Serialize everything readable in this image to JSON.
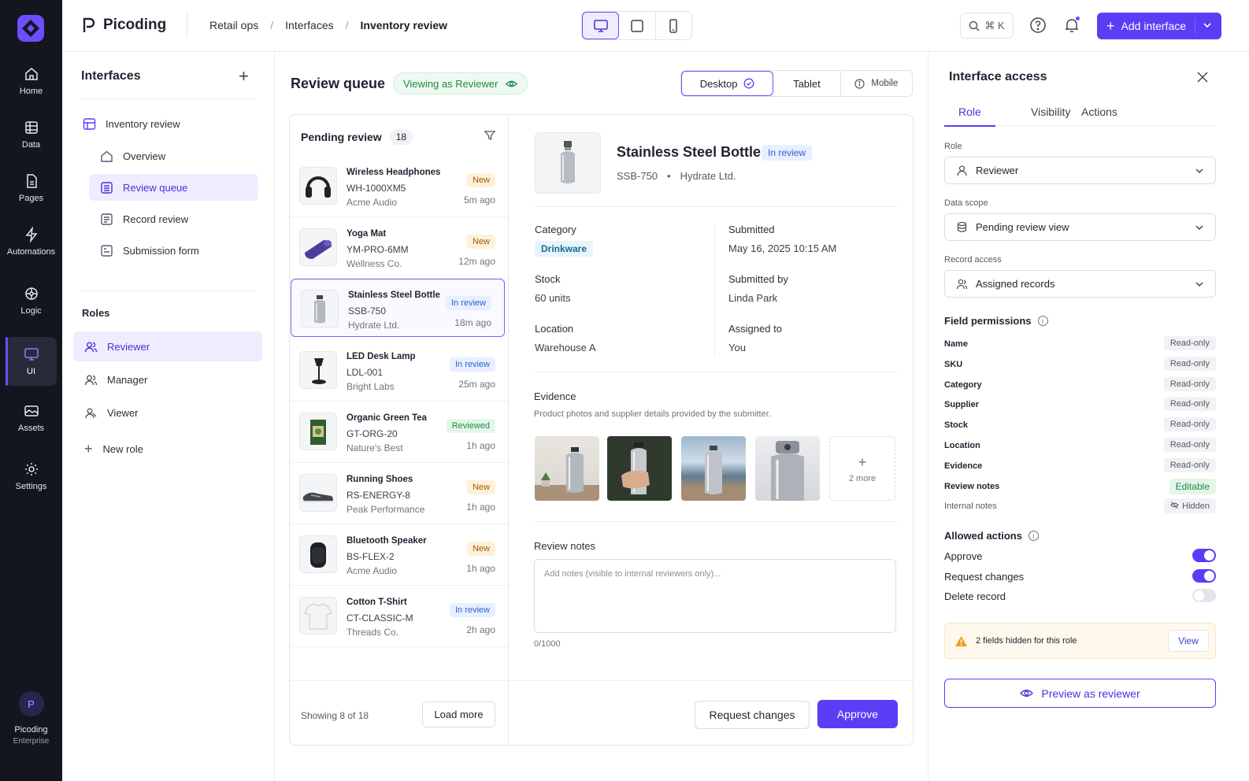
{
  "rail": {
    "items": [
      {
        "label": "Home",
        "icon": "home-icon"
      },
      {
        "label": "Data",
        "icon": "table-icon"
      },
      {
        "label": "Pages",
        "icon": "page-icon"
      },
      {
        "label": "Automations",
        "icon": "bolt-icon"
      },
      {
        "label": "Logic",
        "icon": "logic-icon"
      },
      {
        "label": "UI",
        "icon": "monitor-icon"
      },
      {
        "label": "Assets",
        "icon": "image-icon"
      },
      {
        "label": "Settings",
        "icon": "gear-icon"
      }
    ],
    "user": {
      "initial": "P",
      "name": "Picoding",
      "plan": "Enterprise"
    }
  },
  "topbar": {
    "brand": "Picoding",
    "crumbs": [
      "Retail ops",
      "Interfaces",
      "Inventory review"
    ],
    "search_shortcut": "⌘ K",
    "add_label": "Add interface"
  },
  "nav": {
    "title": "Interfaces",
    "items": [
      "Inventory review",
      "Overview",
      "Review queue",
      "Record review",
      "Submission form"
    ],
    "roles_title": "Roles",
    "roles": [
      "Reviewer",
      "Manager",
      "Viewer",
      "New role"
    ]
  },
  "main": {
    "title": "Review queue",
    "viewing": "Viewing as Reviewer",
    "device_tabs": [
      "Desktop",
      "Tablet",
      "Mobile"
    ],
    "list": {
      "title": "Pending review",
      "count": "18",
      "rows": [
        {
          "name": "Wireless Headphones",
          "sku": "WH-1000XM5",
          "vendor": "Acme Audio",
          "status": "New",
          "time": "5m ago"
        },
        {
          "name": "Yoga Mat",
          "sku": "YM-PRO-6MM",
          "vendor": "Wellness Co.",
          "status": "New",
          "time": "12m ago"
        },
        {
          "name": "Stainless Steel Bottle",
          "sku": "SSB-750",
          "vendor": "Hydrate Ltd.",
          "status": "In review",
          "time": "18m ago"
        },
        {
          "name": "LED Desk Lamp",
          "sku": "LDL-001",
          "vendor": "Bright Labs",
          "status": "In review",
          "time": "25m ago"
        },
        {
          "name": "Organic Green Tea",
          "sku": "GT-ORG-20",
          "vendor": "Nature's Best",
          "status": "Reviewed",
          "time": "1h ago"
        },
        {
          "name": "Running Shoes",
          "sku": "RS-ENERGY-8",
          "vendor": "Peak Performance",
          "status": "New",
          "time": "1h ago"
        },
        {
          "name": "Bluetooth Speaker",
          "sku": "BS-FLEX-2",
          "vendor": "Acme Audio",
          "status": "New",
          "time": "1h ago"
        },
        {
          "name": "Cotton T-Shirt",
          "sku": "CT-CLASSIC-M",
          "vendor": "Threads Co.",
          "status": "In review",
          "time": "2h ago"
        }
      ],
      "showing": "Showing 8 of 18",
      "load_more": "Load more"
    },
    "detail": {
      "name": "Stainless Steel Bottle",
      "status": "In review",
      "sku": "SSB-750",
      "vendor": "Hydrate Ltd.",
      "category_label": "Category",
      "category": "Drinkware",
      "submitted_label": "Submitted",
      "submitted": "May 16, 2025 10:15 AM",
      "stock_label": "Stock",
      "stock": "60 units",
      "submitted_by_label": "Submitted by",
      "submitted_by": "Linda Park",
      "location_label": "Location",
      "location": "Warehouse A",
      "assigned_label": "Assigned to",
      "assigned": "You",
      "evidence_title": "Evidence",
      "evidence_sub": "Product photos and supplier details provided by the submitter.",
      "more": "2 more",
      "notes_title": "Review notes",
      "notes_placeholder": "Add notes (visible to internal reviewers only)...",
      "notes_count": "0/1000",
      "request_changes": "Request changes",
      "approve": "Approve"
    }
  },
  "access": {
    "title": "Interface access",
    "tabs": [
      "Role",
      "Visibility",
      "Actions"
    ],
    "role_label": "Role",
    "role": "Reviewer",
    "scope_label": "Data scope",
    "scope": "Pending review view",
    "record_label": "Record access",
    "record": "Assigned records",
    "fields_title": "Field permissions",
    "fields": [
      {
        "name": "Name",
        "perm": "Read-only"
      },
      {
        "name": "SKU",
        "perm": "Read-only"
      },
      {
        "name": "Category",
        "perm": "Read-only"
      },
      {
        "name": "Supplier",
        "perm": "Read-only"
      },
      {
        "name": "Stock",
        "perm": "Read-only"
      },
      {
        "name": "Location",
        "perm": "Read-only"
      },
      {
        "name": "Evidence",
        "perm": "Read-only"
      },
      {
        "name": "Review notes",
        "perm": "Editable"
      },
      {
        "name": "Internal notes",
        "perm": "Hidden"
      }
    ],
    "actions_title": "Allowed actions",
    "actions": [
      {
        "name": "Approve",
        "enabled": true
      },
      {
        "name": "Request changes",
        "enabled": true
      },
      {
        "name": "Delete record",
        "enabled": false
      }
    ],
    "warning": "2 fields hidden for this role",
    "view": "View",
    "preview": "Preview as reviewer"
  },
  "colors": {
    "accent": "#5b3df5",
    "rail": "#14161f",
    "success": "#1d8a45",
    "warning": "#f0a020"
  }
}
